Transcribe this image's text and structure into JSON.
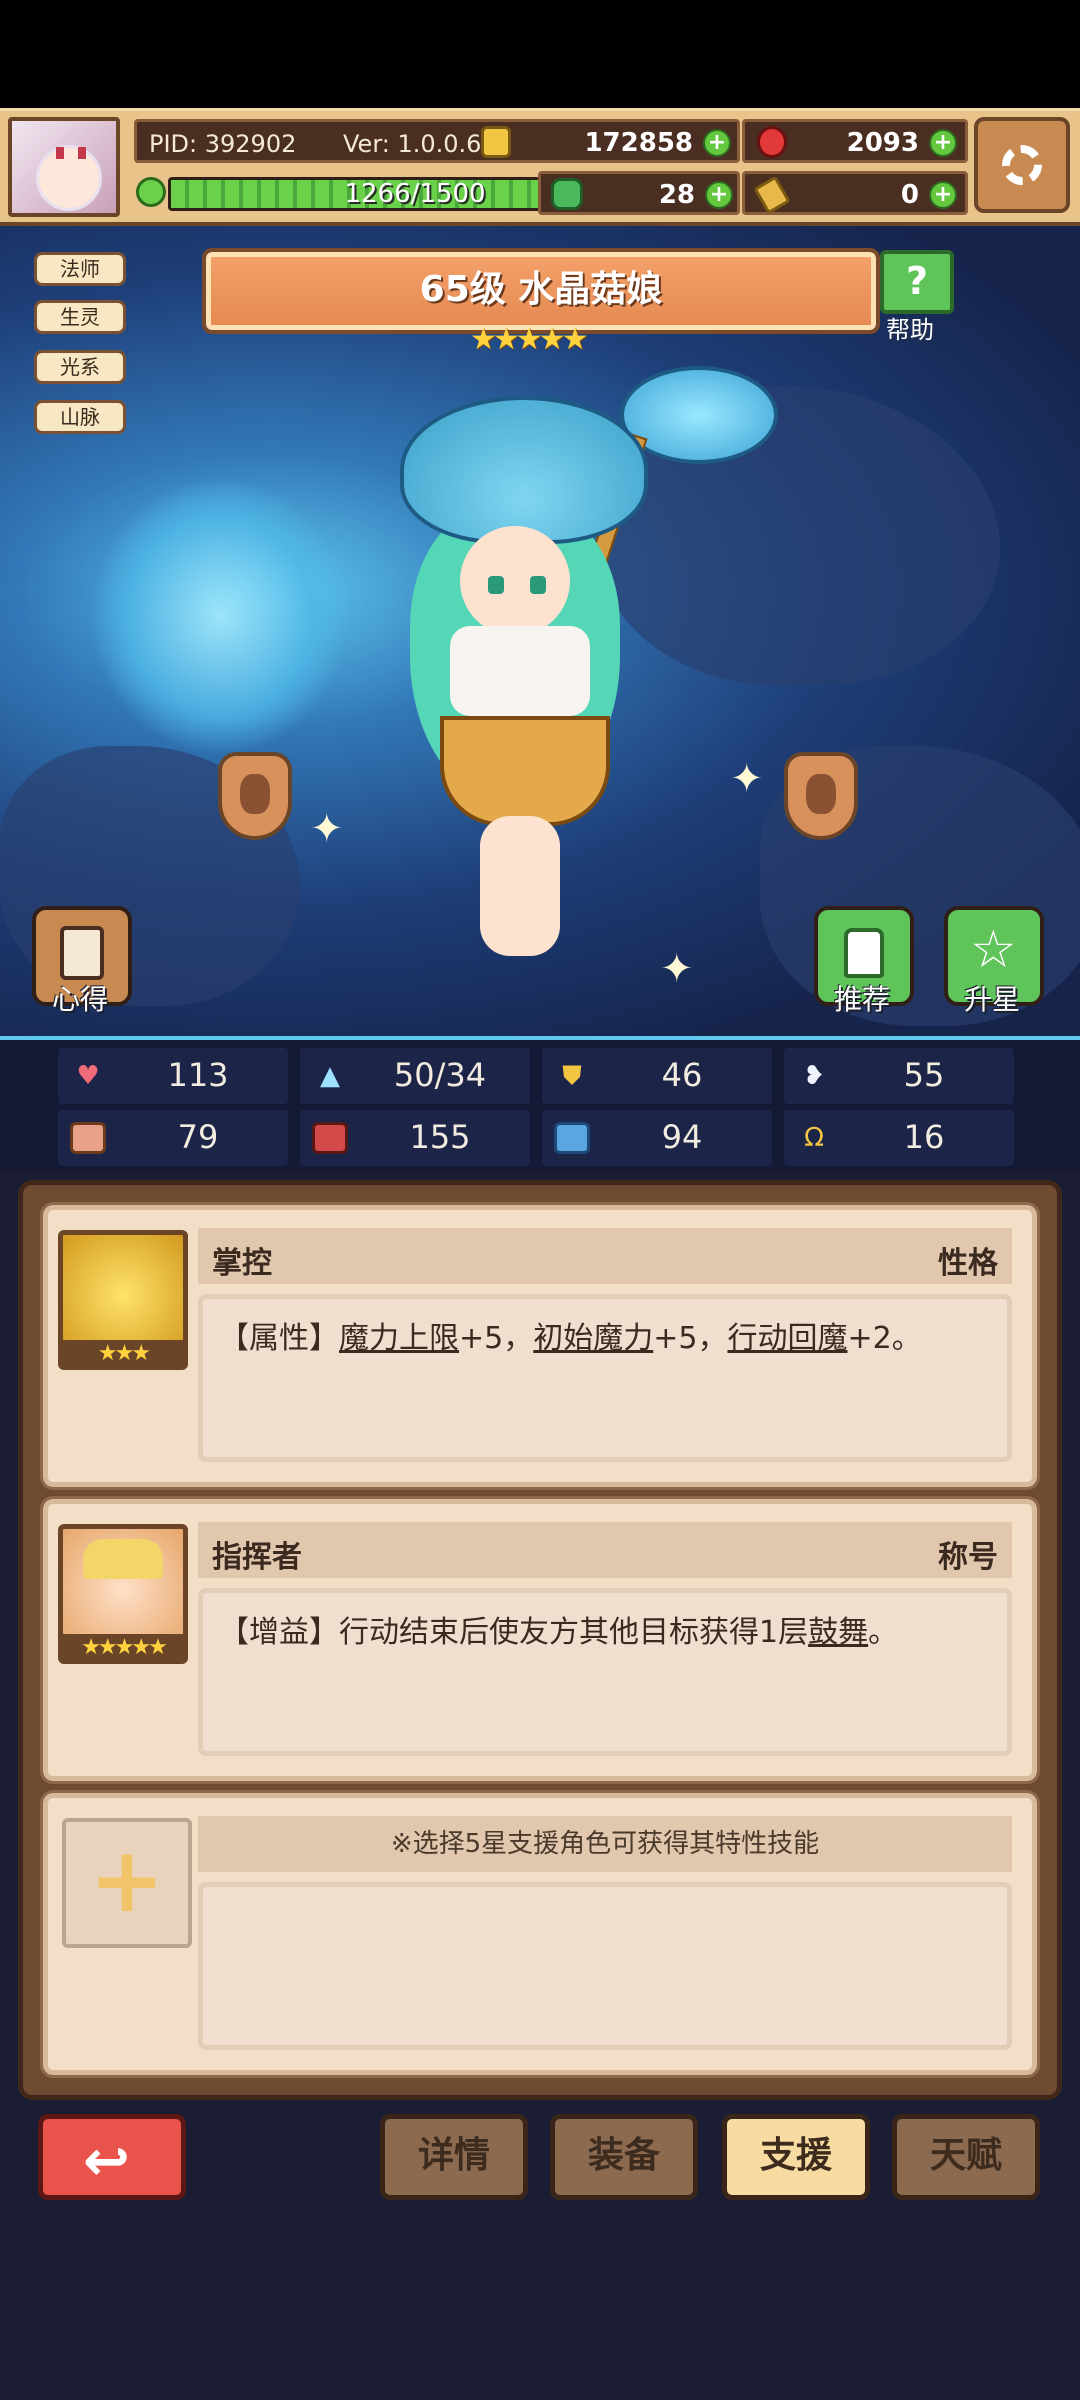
{
  "header": {
    "pid": "PID: 392902",
    "version": "Ver: 1.0.0.6",
    "gold": "172858",
    "gems": "2093",
    "exp": "1266/1500",
    "exp_fraction": 0.844,
    "clover": "28",
    "key": "0"
  },
  "character": {
    "tags": [
      "法师",
      "生灵",
      "光系",
      "山脉"
    ],
    "title": "65级 水晶菇娘",
    "stars": "★★★★★",
    "help_label": "帮助",
    "left_button": "心得",
    "right_buttons": [
      "推荐",
      "升星"
    ]
  },
  "stats": [
    {
      "icon": "heart-icon",
      "value": "113"
    },
    {
      "icon": "mana-drop-icon",
      "value": "50/34"
    },
    {
      "icon": "shield-icon",
      "value": "46"
    },
    {
      "icon": "wing-icon",
      "value": "55"
    },
    {
      "icon": "fist-icon",
      "value": "79"
    },
    {
      "icon": "book-icon",
      "value": "155"
    },
    {
      "icon": "boot-icon",
      "value": "94"
    },
    {
      "icon": "horseshoe-icon",
      "value": "16"
    }
  ],
  "cards": [
    {
      "title": "掌控",
      "type": "性格",
      "stars": "★★★",
      "text_prefix": "【属性】",
      "seg1": "魔力上限",
      "seg2": "+5，",
      "seg3": "初始魔力",
      "seg4": "+5，",
      "seg5": "行动回魔",
      "seg6": "+2。"
    },
    {
      "title": "指挥者",
      "type": "称号",
      "stars": "★★★★★",
      "text_prefix": "【增益】",
      "seg1": "行动结束后使友方其他目标获得1层",
      "seg2": "鼓舞",
      "seg3": "。"
    },
    {
      "hint": "※选择5星支援角色可获得其特性技能"
    }
  ],
  "bottom": {
    "tabs": [
      "详情",
      "装备",
      "支援",
      "天赋"
    ],
    "active": "支援"
  }
}
